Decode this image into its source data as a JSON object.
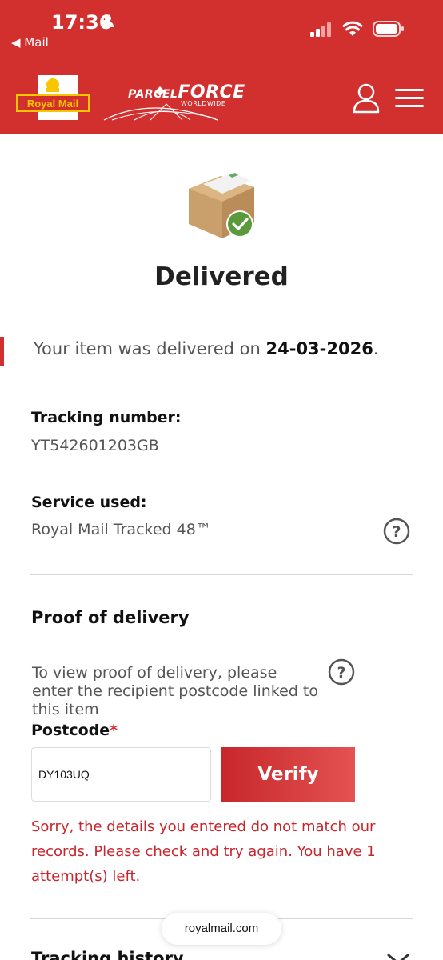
{
  "status_bar": {
    "time": "17:36",
    "back_app": "◀ Mail"
  },
  "header": {
    "brand_logo_text": "Royal Mail",
    "secondary_logo_text": "PARCELFORCE WORLDWIDE",
    "parcelforce_prefix": "PARCEL",
    "parcelforce_main": "FORCE",
    "parcelforce_sub": "WORLDWIDE",
    "colors": {
      "brand_red": "#d1302f",
      "logo_yellow": "#f7c600"
    }
  },
  "status": {
    "title": "Delivered",
    "message_prefix": "Your item was delivered on",
    "date": "24-03-2026",
    "message_suffix": "."
  },
  "tracking": {
    "label": "Tracking number:",
    "value": "YT542601203GB"
  },
  "service": {
    "label": "Service used:",
    "value": "Royal Mail Tracked 48™"
  },
  "proof_of_delivery": {
    "title": "Proof of delivery",
    "instructions": "To view proof of delivery, please enter the recipient postcode linked to this item",
    "postcode_label": "Postcode",
    "required_marker": "*",
    "postcode_value": "DY103UQ",
    "verify_label": "Verify",
    "error": "Sorry, the details you entered do not match our records. Please check and try again. You have 1 attempt(s) left."
  },
  "history": {
    "title": "Tracking history"
  },
  "browser": {
    "url": "royalmail.com"
  }
}
